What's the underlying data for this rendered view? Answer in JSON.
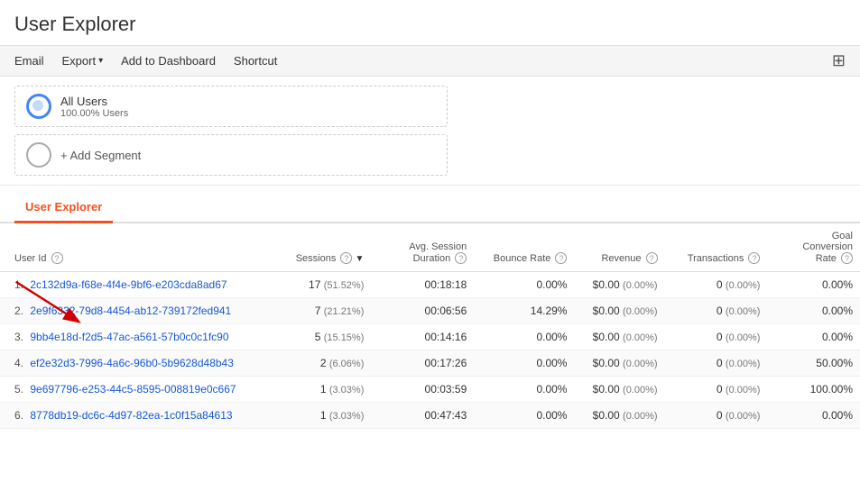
{
  "page": {
    "title": "User Explorer"
  },
  "toolbar": {
    "email_label": "Email",
    "export_label": "Export",
    "add_to_dashboard_label": "Add to Dashboard",
    "shortcut_label": "Shortcut"
  },
  "segments": [
    {
      "name": "All Users",
      "sub": "100.00% Users"
    }
  ],
  "add_segment_label": "+ Add Segment",
  "tabs": [
    {
      "label": "User Explorer",
      "active": true
    }
  ],
  "table": {
    "columns": [
      {
        "label": "User Id",
        "help": true,
        "align": "left",
        "sortable": false
      },
      {
        "label": "Sessions",
        "help": true,
        "align": "right",
        "sortable": true
      },
      {
        "label": "Avg. Session Duration",
        "help": true,
        "align": "right",
        "sortable": false
      },
      {
        "label": "Bounce Rate",
        "help": true,
        "align": "right",
        "sortable": false
      },
      {
        "label": "Revenue",
        "help": true,
        "align": "right",
        "sortable": false
      },
      {
        "label": "Transactions",
        "help": true,
        "align": "right",
        "sortable": false
      },
      {
        "label": "Goal Conversion Rate",
        "help": true,
        "align": "right",
        "sortable": false
      }
    ],
    "rows": [
      {
        "num": "1.",
        "userId": "2c132d9a-f68e-4f4e-9bf6-e203cda8ad67",
        "sessions": "17",
        "sessionsPct": "(51.52%)",
        "avgDuration": "00:18:18",
        "bounceRate": "0.00%",
        "revenue": "$0.00",
        "revenuePct": "(0.00%)",
        "transactions": "0",
        "transactionsPct": "(0.00%)",
        "goalRate": "0.00%"
      },
      {
        "num": "2.",
        "userId": "2e9f6332-79d8-4454-ab12-739172fed941",
        "sessions": "7",
        "sessionsPct": "(21.21%)",
        "avgDuration": "00:06:56",
        "bounceRate": "14.29%",
        "revenue": "$0.00",
        "revenuePct": "(0.00%)",
        "transactions": "0",
        "transactionsPct": "(0.00%)",
        "goalRate": "0.00%"
      },
      {
        "num": "3.",
        "userId": "9bb4e18d-f2d5-47ac-a561-57b0c0c1fc90",
        "sessions": "5",
        "sessionsPct": "(15.15%)",
        "avgDuration": "00:14:16",
        "bounceRate": "0.00%",
        "revenue": "$0.00",
        "revenuePct": "(0.00%)",
        "transactions": "0",
        "transactionsPct": "(0.00%)",
        "goalRate": "0.00%"
      },
      {
        "num": "4.",
        "userId": "ef2e32d3-7996-4a6c-96b0-5b9628d48b43",
        "sessions": "2",
        "sessionsPct": "(6.06%)",
        "avgDuration": "00:17:26",
        "bounceRate": "0.00%",
        "revenue": "$0.00",
        "revenuePct": "(0.00%)",
        "transactions": "0",
        "transactionsPct": "(0.00%)",
        "goalRate": "50.00%"
      },
      {
        "num": "5.",
        "userId": "9e697796-e253-44c5-8595-008819e0c667",
        "sessions": "1",
        "sessionsPct": "(3.03%)",
        "avgDuration": "00:03:59",
        "bounceRate": "0.00%",
        "revenue": "$0.00",
        "revenuePct": "(0.00%)",
        "transactions": "0",
        "transactionsPct": "(0.00%)",
        "goalRate": "100.00%"
      },
      {
        "num": "6.",
        "userId": "8778db19-dc6c-4d97-82ea-1c0f15a84613",
        "sessions": "1",
        "sessionsPct": "(3.03%)",
        "avgDuration": "00:47:43",
        "bounceRate": "0.00%",
        "revenue": "$0.00",
        "revenuePct": "(0.00%)",
        "transactions": "0",
        "transactionsPct": "(0.00%)",
        "goalRate": "0.00%"
      }
    ]
  }
}
